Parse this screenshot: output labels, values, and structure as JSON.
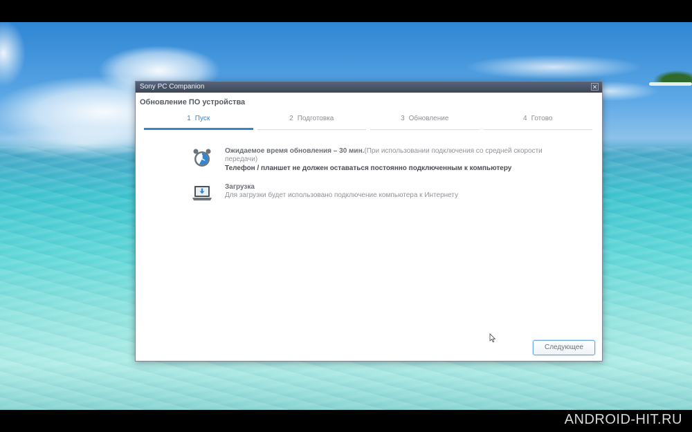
{
  "window": {
    "app_title": "Sony PC Companion",
    "close_glyph": "✕",
    "page_title": "Обновление ПО устройства"
  },
  "steps": [
    {
      "num": "1",
      "label": "Пуск",
      "active": true
    },
    {
      "num": "2",
      "label": "Подготовка",
      "active": false
    },
    {
      "num": "3",
      "label": "Обновление",
      "active": false
    },
    {
      "num": "4",
      "label": "Готово",
      "active": false
    }
  ],
  "info": {
    "time_lead": "Ожидаемое время обновления – 30 мин.",
    "time_note": "(При использовании подключения со средней скорости передачи)",
    "connection_warning": "Телефон / планшет не должен оставаться постоянно подключенным к компьютеру",
    "download_title": "Загрузка",
    "download_note": "Для загрузки будет использовано подключение компьютера к Интернету"
  },
  "buttons": {
    "next_label": "Следующее"
  },
  "watermark": "ANDROID-HIT.RU",
  "icons": {
    "timer": "alarm-clock-icon",
    "download": "laptop-download-icon",
    "cursor": "mouse-cursor-icon"
  },
  "colors": {
    "accent": "#2f86d3",
    "titlebar": "#4a5468"
  }
}
